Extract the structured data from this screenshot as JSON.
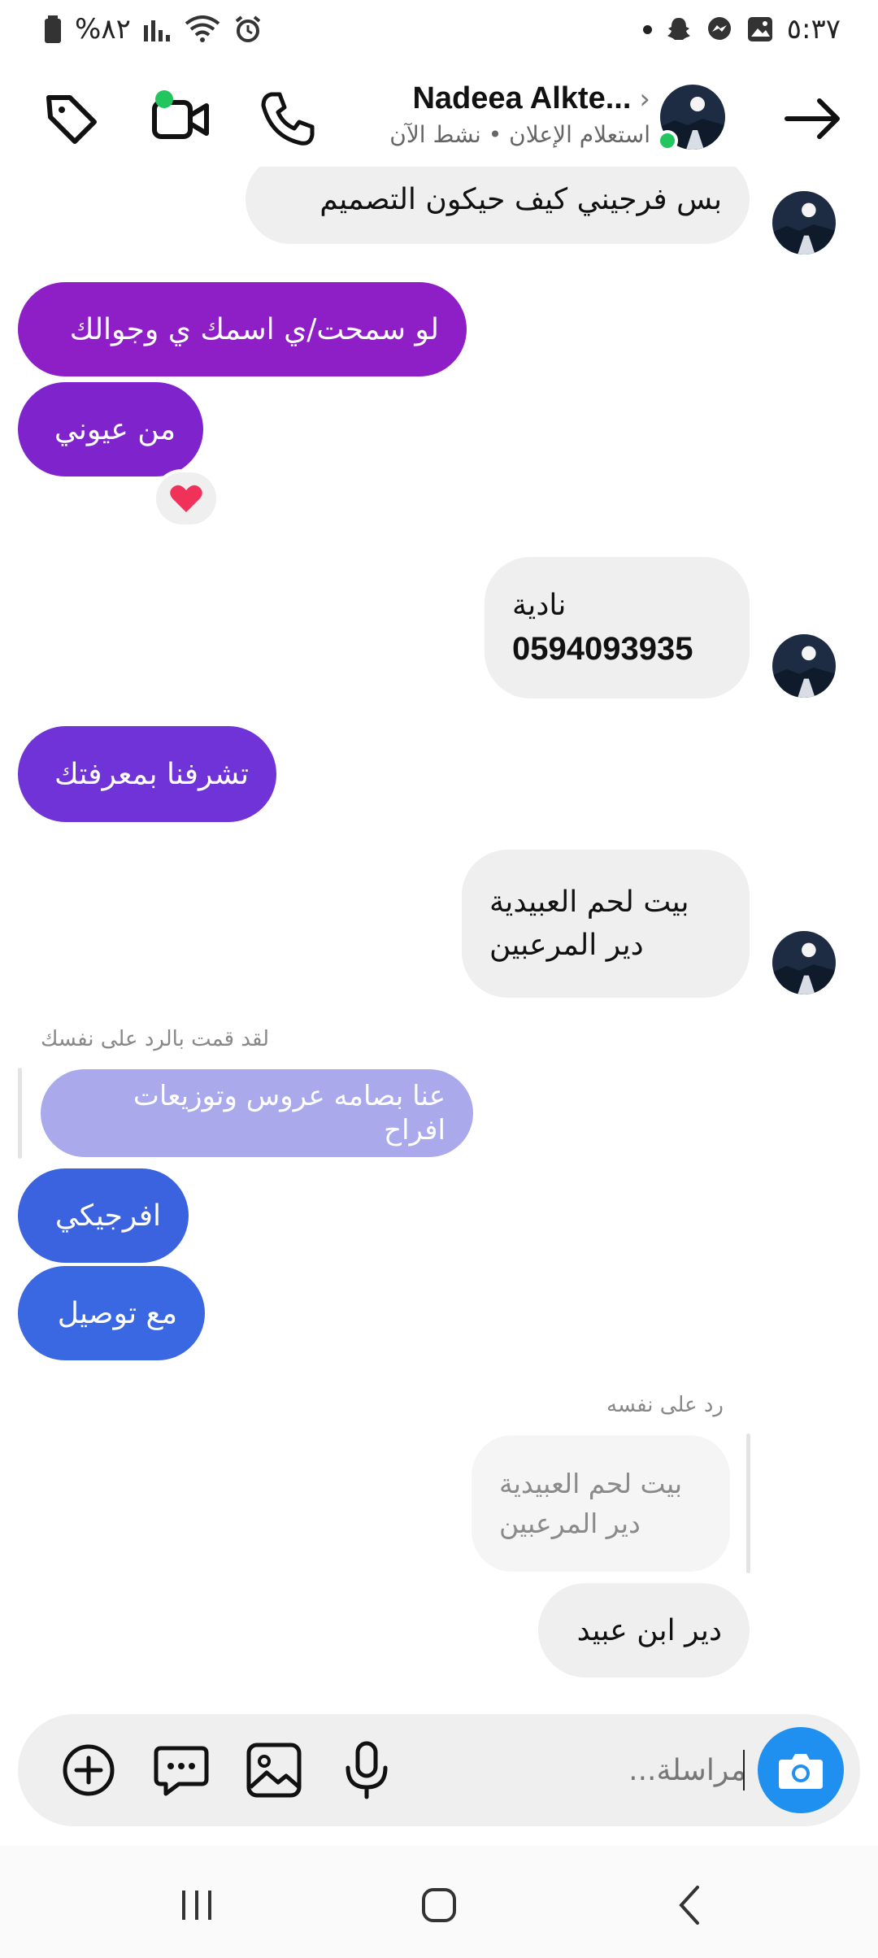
{
  "status": {
    "time": "٥:٣٧",
    "battery": "%٨٢"
  },
  "header": {
    "name": "Nadeea Alkte...",
    "subtitle": "استعلام الإعلان • نشط الآن",
    "online_color": "#22c55e"
  },
  "messages": {
    "m1": "بس فرجيني كيف  حيكون التصميم",
    "m2": "لو سمحت/ي اسمك ي وجوالك",
    "m3": "من عيوني",
    "m3_reaction": "❤️",
    "m4_line1": "نادية",
    "m4_line2": "0594093935",
    "m5": "تشرفنا بمعرفتك",
    "m6_line1": "بيت لحم العبيدية",
    "m6_line2": "دير المرعبين",
    "reply_meta_1": "لقد قمت بالرد على نفسك",
    "quoted_1": "عنا بصامه عروس وتوزيعات افراح",
    "m7": "افرجيكي",
    "m8": "مع توصيل",
    "reply_meta_2": "رد على نفسه",
    "quoted_2_line1": "بيت لحم العبيدية",
    "quoted_2_line2": "دير المرعبين",
    "m9": "دير ابن عبيد"
  },
  "colors": {
    "purple_1": "#8e1fc6",
    "purple_2": "#6f33d8",
    "blue": "#3b63e0",
    "quoted_out": "#aaa9ec",
    "accent": "#1f8ff0"
  },
  "composer": {
    "placeholder": "مراسلة..."
  }
}
